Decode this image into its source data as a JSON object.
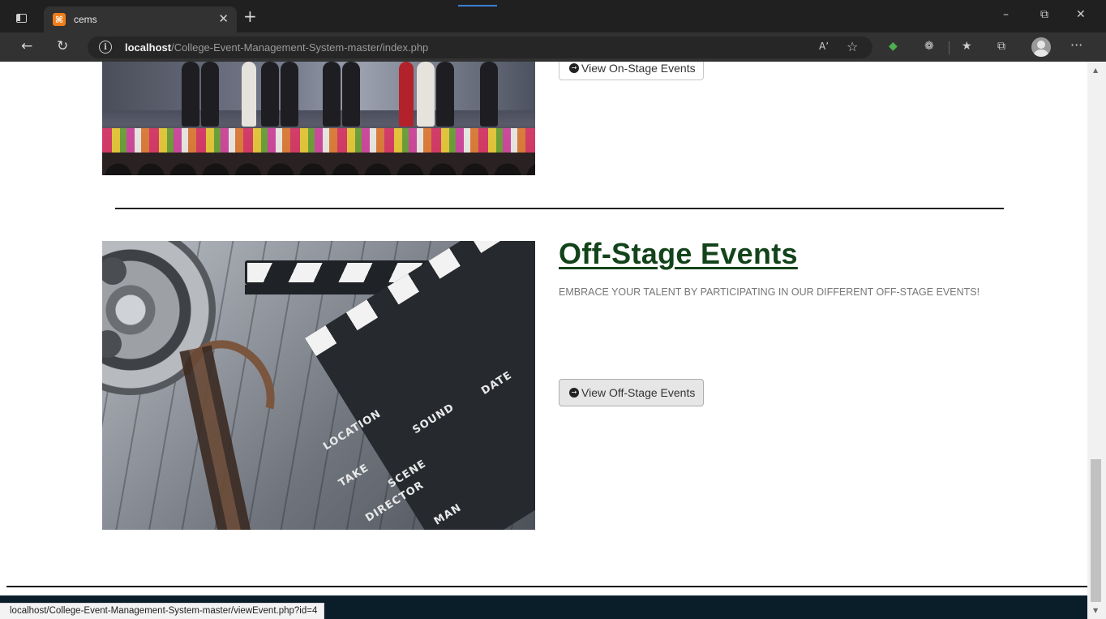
{
  "browser": {
    "tab_title": "cems",
    "tab_favicon_glyph": "⌘",
    "new_tab_glyph": "+",
    "tab_close_glyph": "✕",
    "window_controls": {
      "minimize": "–",
      "maximize": "⧉",
      "close": "✕"
    },
    "nav": {
      "back_glyph": "←",
      "refresh_glyph": "↻"
    },
    "address": {
      "host": "localhost",
      "path": "/College-Event-Management-System-master/index.php"
    },
    "toolbar_icons": {
      "read_aloud": "Aʼ",
      "add_favorite": "☆",
      "extension": "◆",
      "copilot": "❁",
      "favorites": "★",
      "collections": "⧉",
      "more": "···"
    }
  },
  "page": {
    "onstage": {
      "button_label": "View On-Stage Events",
      "button_icon": "→"
    },
    "offstage": {
      "title": "Off-Stage Events",
      "description": "EMBRACE YOUR TALENT BY PARTICIPATING IN OUR DIFFERENT OFF-STAGE EVENTS!",
      "button_label": "View Off-Stage Events",
      "button_icon": "→",
      "image_labels": {
        "location": "LOCATION",
        "sound": "SOUND",
        "date": "DATE",
        "take": "TAKE",
        "scene": "SCENE",
        "director": "DIRECTOR",
        "cameraman": "MAN"
      }
    }
  },
  "scrollbar": {
    "up_glyph": "▲",
    "down_glyph": "▼"
  },
  "status_bar": {
    "url": "localhost/College-Event-Management-System-master/viewEvent.php?id=4"
  },
  "colors": {
    "title": "#13431a",
    "footer": "#0a1e2a",
    "chrome_dark": "#202020"
  }
}
